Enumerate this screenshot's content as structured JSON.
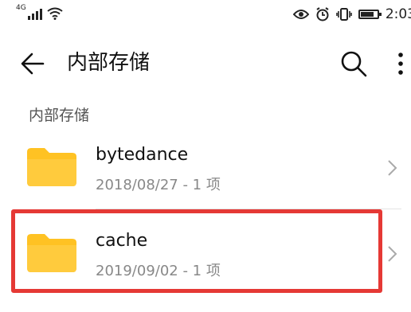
{
  "status_bar": {
    "network_type": "4G",
    "time": "2:03",
    "battery_level": 0.8
  },
  "toolbar": {
    "title": "内部存储",
    "back_icon": "arrow-left-icon",
    "search_icon": "search-icon",
    "more_icon": "more-vertical-icon"
  },
  "breadcrumb": {
    "label": "内部存储"
  },
  "files": [
    {
      "name": "bytedance",
      "meta": "2018/08/27 - 1 项",
      "icon": "folder-icon"
    },
    {
      "name": "cache",
      "meta": "2019/09/02 - 1 项",
      "icon": "folder-icon"
    }
  ],
  "colors": {
    "folder": "#FFC223",
    "highlight": "#E53935",
    "meta_text": "#888888"
  }
}
